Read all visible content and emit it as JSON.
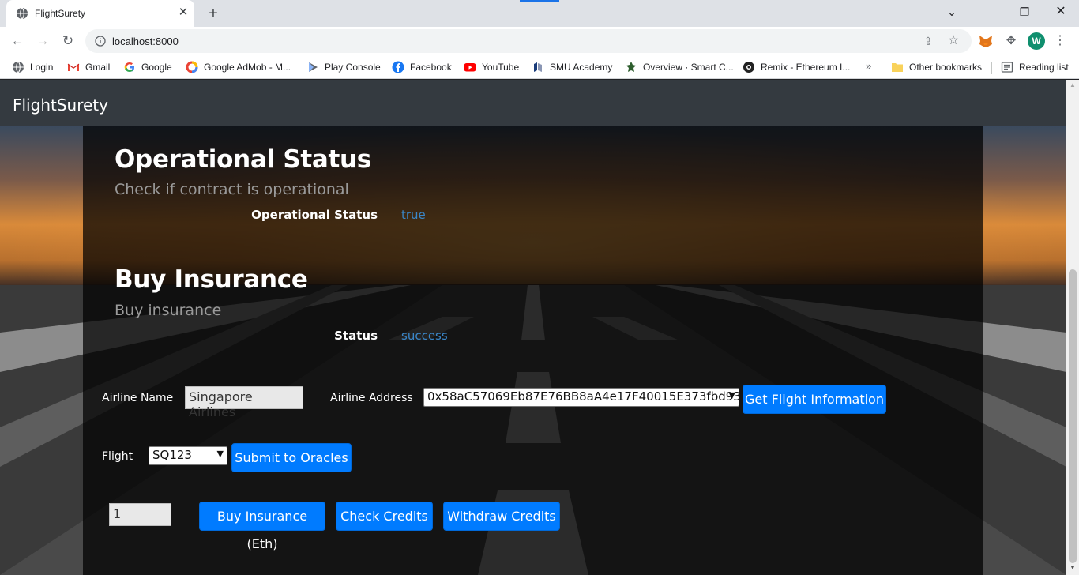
{
  "browser": {
    "tab_title": "FlightSurety",
    "url": "localhost:8000",
    "avatar_letter": "W",
    "bookmarks": [
      {
        "label": "Login",
        "icon": "globe-icon"
      },
      {
        "label": "Gmail",
        "icon": "gmail-icon"
      },
      {
        "label": "Google",
        "icon": "google-icon"
      },
      {
        "label": "Google AdMob - M...",
        "icon": "admob-icon"
      },
      {
        "label": "Play Console",
        "icon": "play-console-icon"
      },
      {
        "label": "Facebook",
        "icon": "facebook-icon"
      },
      {
        "label": "YouTube",
        "icon": "youtube-icon"
      },
      {
        "label": "SMU Academy",
        "icon": "smu-icon"
      },
      {
        "label": "Overview · Smart C...",
        "icon": "leaf-icon"
      },
      {
        "label": "Remix - Ethereum I...",
        "icon": "remix-icon"
      }
    ],
    "more_bookmarks": "»",
    "other_bookmarks": "Other bookmarks",
    "reading_list": "Reading list"
  },
  "app": {
    "brand": "FlightSurety",
    "operational": {
      "title": "Operational Status",
      "subtitle": "Check if contract is operational",
      "label": "Operational Status",
      "value": "true"
    },
    "insurance": {
      "title": "Buy Insurance",
      "subtitle": "Buy insurance",
      "status_label": "Status",
      "status_value": "success"
    },
    "form": {
      "airline_name_label": "Airline Name",
      "airline_name_value": "Singapore Airlines",
      "airline_address_label": "Airline Address",
      "airline_address_value": "0x58aC57069Eb87E76BB8aA4e17F40015E373fbd93",
      "get_flight_button": "Get Flight Information",
      "flight_label": "Flight",
      "flight_value": "SQ123",
      "submit_oracles_button": "Submit to Oracles",
      "amount_value": "1",
      "buy_button": "Buy Insurance (Eth)",
      "check_credits_button": "Check Credits",
      "withdraw_button": "Withdraw Credits"
    }
  },
  "colors": {
    "accent": "#007bff",
    "navbar": "#343a40",
    "value_text": "#3a86c8"
  }
}
